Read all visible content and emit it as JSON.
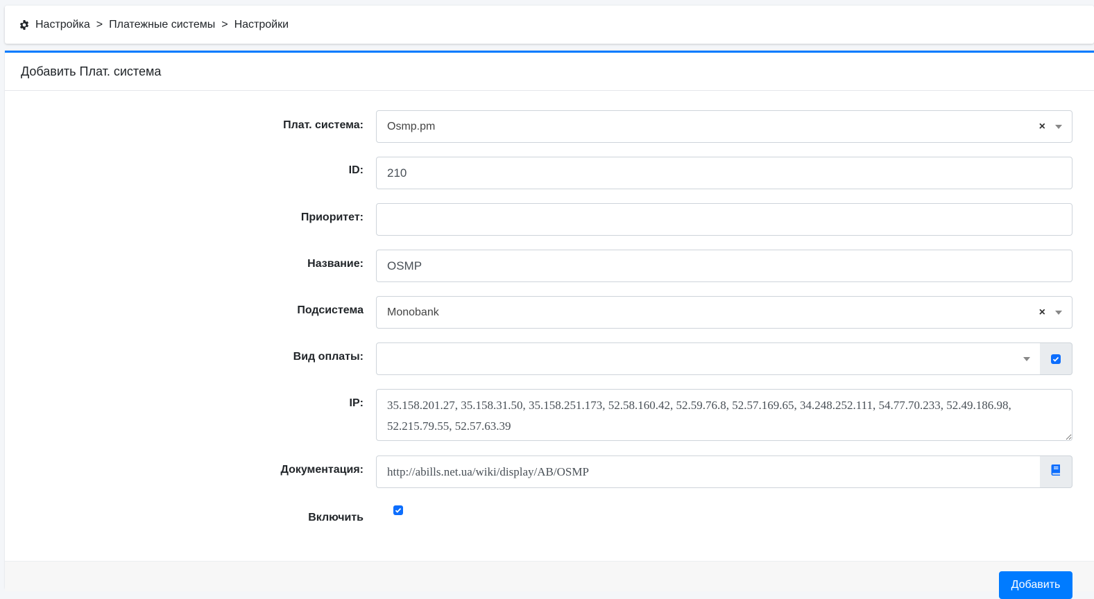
{
  "breadcrumb": {
    "icon": "gear-icon",
    "items": [
      "Настройка",
      "Платежные системы",
      "Настройки"
    ],
    "separator": ">"
  },
  "card": {
    "title": "Добавить Плат. система",
    "accent_color": "#007bff"
  },
  "form": {
    "pay_system": {
      "label": "Плат. система:",
      "value": "Osmp.pm",
      "clear": "×"
    },
    "id": {
      "label": "ID:",
      "value": "210"
    },
    "priority": {
      "label": "Приоритет:",
      "value": ""
    },
    "name": {
      "label": "Название:",
      "value": "OSMP"
    },
    "subsystem": {
      "label": "Подсистема",
      "value": "Monobank",
      "clear": "×"
    },
    "payment_type": {
      "label": "Вид оплаты:",
      "value": "",
      "addon_checked": true
    },
    "ip": {
      "label": "IP:",
      "value": "35.158.201.27, 35.158.31.50, 35.158.251.173, 52.58.160.42, 52.59.76.8, 52.57.169.65, 34.248.252.111, 54.77.70.233, 52.49.186.98, 52.215.79.55, 52.57.63.39"
    },
    "docs": {
      "label": "Документация:",
      "value": "http://abills.net.ua/wiki/display/AB/OSMP",
      "addon_icon": "book-icon"
    },
    "enable": {
      "label": "Включить",
      "checked": true
    }
  },
  "footer": {
    "submit_label": "Добавить"
  }
}
